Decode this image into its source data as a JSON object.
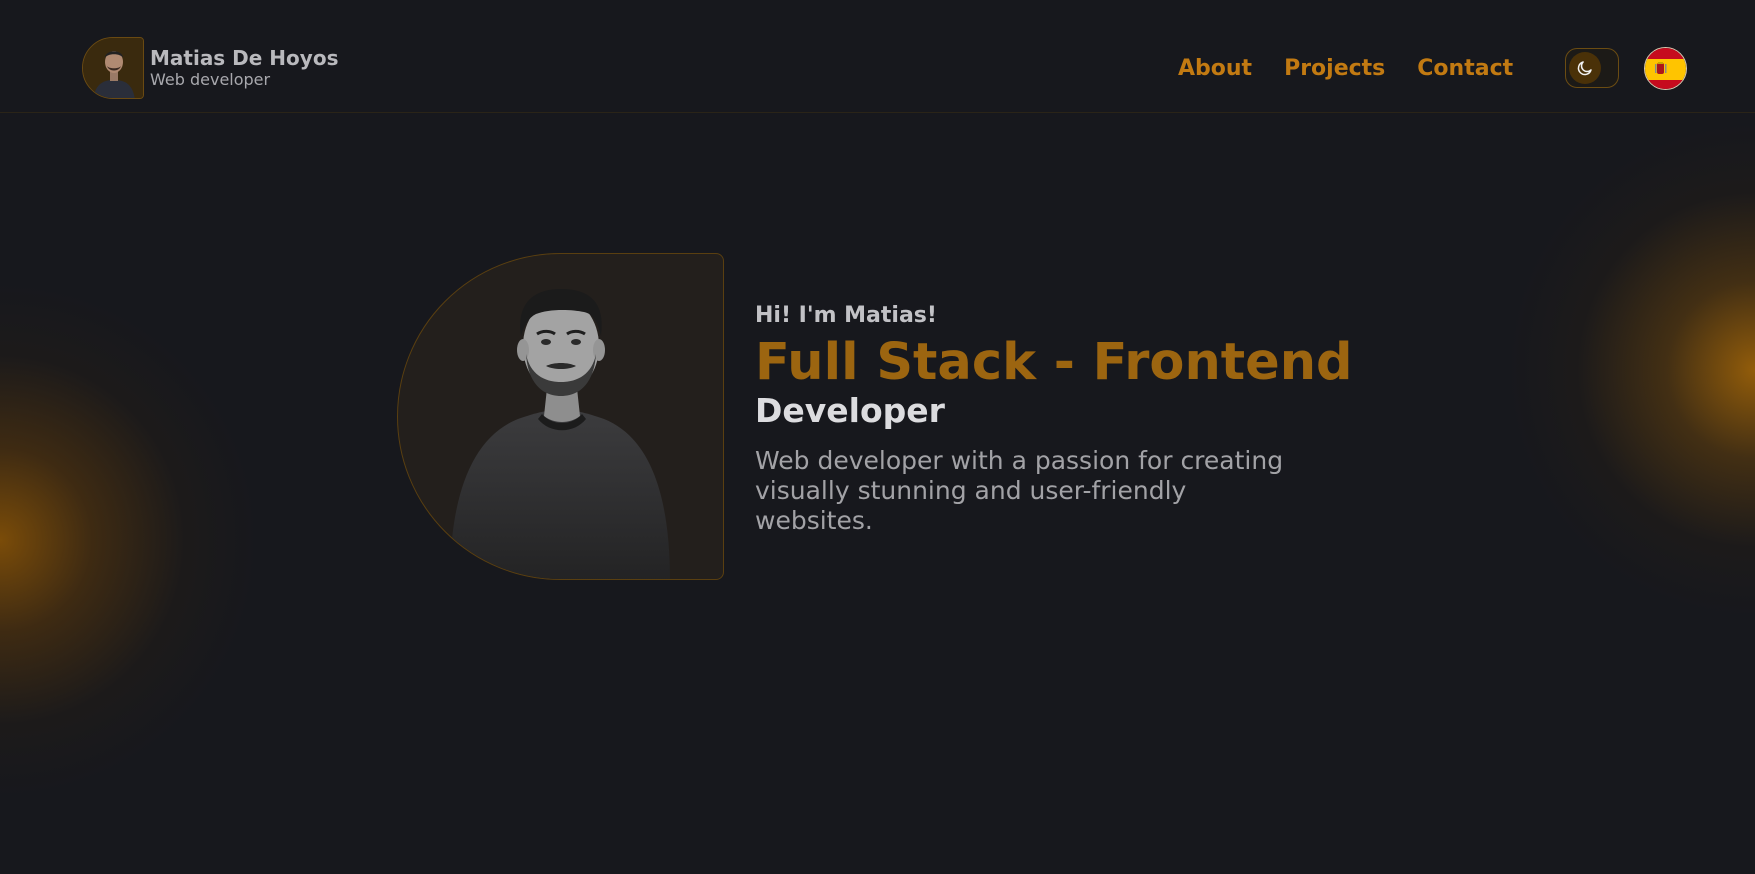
{
  "header": {
    "name": "Matias De Hoyos",
    "role": "Web developer",
    "nav": [
      {
        "label": "About"
      },
      {
        "label": "Projects"
      },
      {
        "label": "Contact"
      }
    ],
    "theme_toggle_icon": "moon-icon",
    "language_flag_icon": "spain-flag-icon"
  },
  "hero": {
    "greeting": "Hi! I'm Matias!",
    "title": "Full Stack - Frontend",
    "subtitle": "Developer",
    "description": "Web developer with a passion for creating visually stunning and user-friendly websites."
  },
  "colors": {
    "background": "#17181d",
    "accent": "#c27a12",
    "title": "#9c6510"
  }
}
